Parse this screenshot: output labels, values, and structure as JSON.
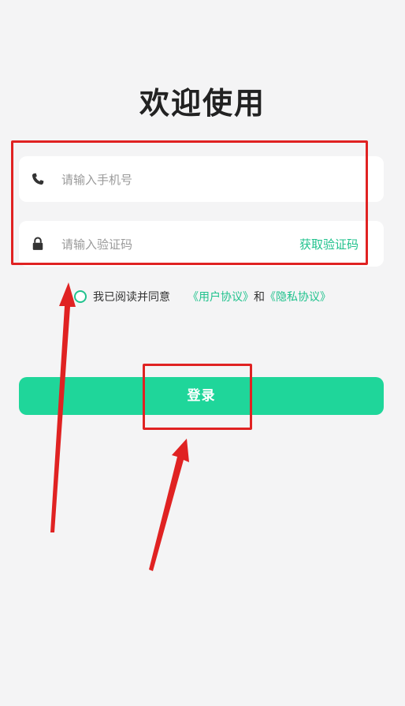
{
  "page": {
    "title": "欢迎使用"
  },
  "form": {
    "phone": {
      "placeholder": "请输入手机号",
      "icon": "phone-icon"
    },
    "code": {
      "placeholder": "请输入验证码",
      "icon": "lock-icon",
      "get_code_label": "获取验证码"
    }
  },
  "agreement": {
    "prefix": "我已阅读并同意",
    "user_agreement": "《用户协议》",
    "conjunction": "和",
    "privacy_agreement": "《隐私协议》",
    "checked": false
  },
  "login_button": {
    "label": "登录"
  },
  "colors": {
    "accent": "#20c28d",
    "button": "#1fd69a",
    "annotation": "#e02222",
    "background": "#f4f4f5"
  }
}
